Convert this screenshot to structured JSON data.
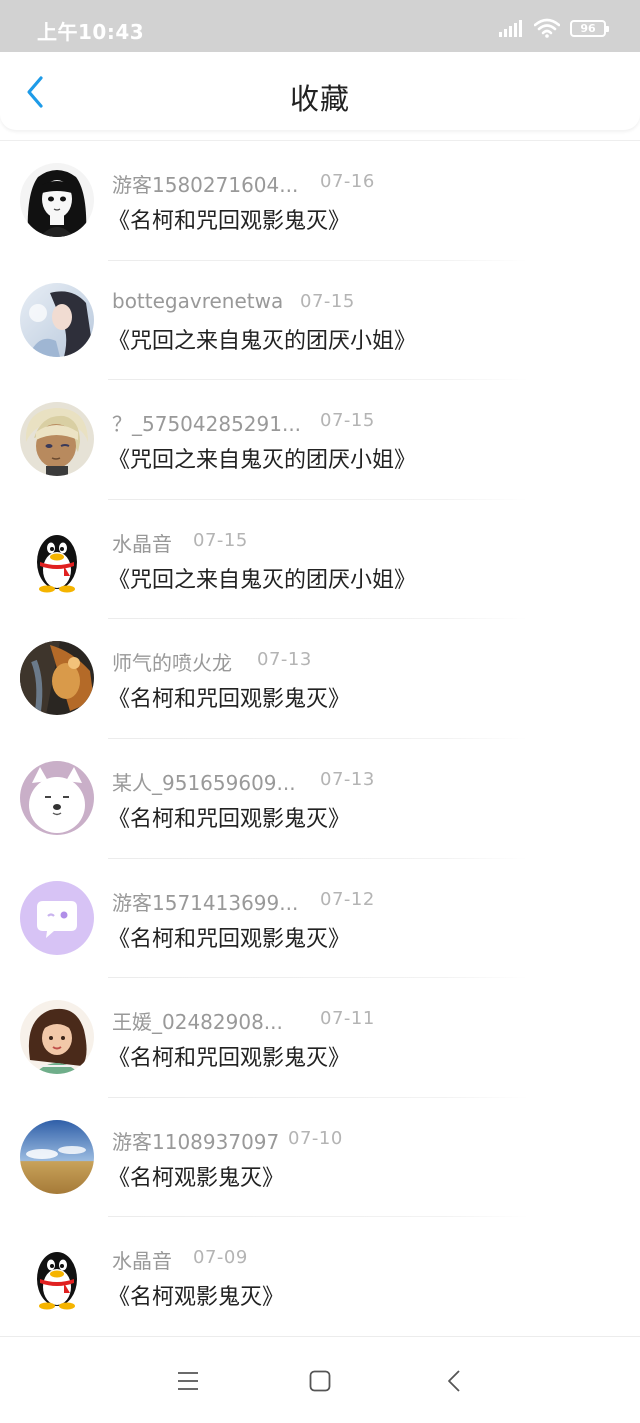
{
  "status_bar": {
    "time": "上午10:43",
    "battery": "96",
    "icons": [
      "signal-icon",
      "wifi-icon",
      "battery-icon"
    ]
  },
  "header": {
    "title": "收藏",
    "back_icon": "chevron-left-icon",
    "accent_color": "#1e9be8"
  },
  "favorites": [
    {
      "user": "游客1580271604...",
      "date": "07-16",
      "title": "《名柯和咒回观影鬼灭》",
      "avatar": "avatar-anime-girl-bw"
    },
    {
      "user": "bottegavrenetwa",
      "date": "07-15",
      "title": "《咒回之来自鬼灭的团厌小姐》",
      "avatar": "avatar-girl-photo"
    },
    {
      "user": "？_57504285291...",
      "date": "07-15",
      "title": "《咒回之来自鬼灭的团厌小姐》",
      "avatar": "avatar-anime-blond"
    },
    {
      "user": "水晶音",
      "date": "07-15",
      "title": "《咒回之来自鬼灭的团厌小姐》",
      "avatar": "avatar-qq-penguin"
    },
    {
      "user": "师气的喷火龙",
      "date": "07-13",
      "title": "《名柯和咒回观影鬼灭》",
      "avatar": "avatar-dark-photo"
    },
    {
      "user": "某人_951659609...",
      "date": "07-13",
      "title": "《名柯和咒回观影鬼灭》",
      "avatar": "avatar-white-dog"
    },
    {
      "user": "游客1571413699...",
      "date": "07-12",
      "title": "《名柯和咒回观影鬼灭》",
      "avatar": "avatar-purple-chat"
    },
    {
      "user": "王媛_02482908...",
      "date": "07-11",
      "title": "《名柯和咒回观影鬼灭》",
      "avatar": "avatar-cartoon-girl"
    },
    {
      "user": "游客1108937097",
      "date": "07-10",
      "title": "《名柯观影鬼灭》",
      "avatar": "avatar-sky-field"
    },
    {
      "user": "水晶音",
      "date": "07-09",
      "title": "《名柯观影鬼灭》",
      "avatar": "avatar-qq-penguin"
    }
  ],
  "nav_bar": {
    "icons": [
      "menu-icon",
      "home-square-icon",
      "back-triangle-icon"
    ]
  }
}
